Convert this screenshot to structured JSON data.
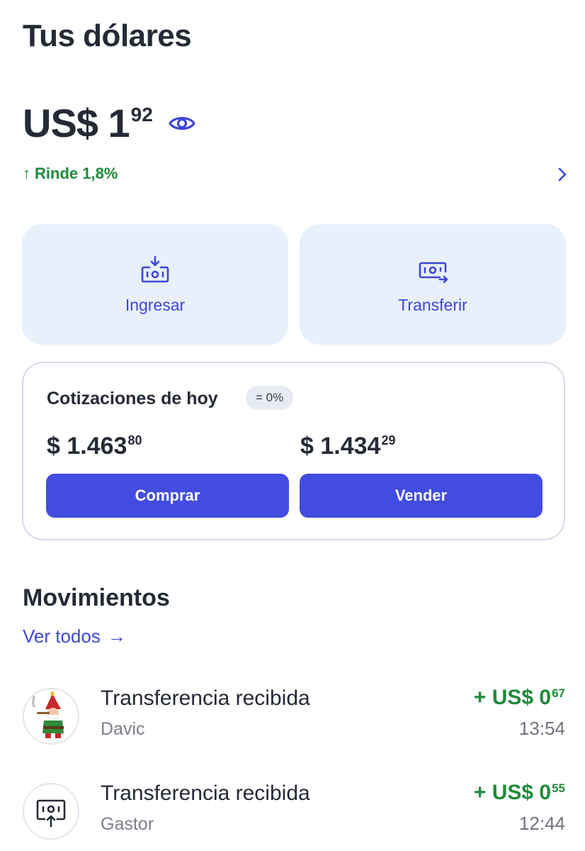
{
  "header": {
    "title": "Tus dólares"
  },
  "balance": {
    "currency_int": "US$ 1",
    "cents": "92",
    "eye_icon": "eye-icon"
  },
  "yield": {
    "arrow": "↑",
    "label": "Rinde 1,8%",
    "color": "#1f8a3a"
  },
  "actions": [
    {
      "label": "Ingresar",
      "icon": "deposit-icon"
    },
    {
      "label": "Transferir",
      "icon": "transfer-icon"
    }
  ],
  "quotes": {
    "title": "Cotizaciones de hoy",
    "badge": "= 0%",
    "buy": {
      "int": "$ 1.463",
      "cents": "80",
      "button": "Comprar"
    },
    "sell": {
      "int": "$ 1.434",
      "cents": "29",
      "button": "Vender"
    }
  },
  "movements": {
    "title": "Movimientos",
    "see_all": "Ver todos",
    "see_all_arrow": "→",
    "items": [
      {
        "title": "Transferencia recibida",
        "subtitle": "Davic",
        "amount_int": "+ US$ 0",
        "amount_cents": "67",
        "time": "13:54",
        "avatar": "gnome-avatar"
      },
      {
        "title": "Transferencia recibida",
        "subtitle": "Gastor",
        "amount_int": "+ US$ 0",
        "amount_cents": "55",
        "time": "12:44",
        "avatar": "receive-transfer-icon"
      }
    ]
  },
  "colors": {
    "accent": "#434ce0",
    "positive": "#1f8a3a",
    "card_bg": "#e8f0fb"
  }
}
